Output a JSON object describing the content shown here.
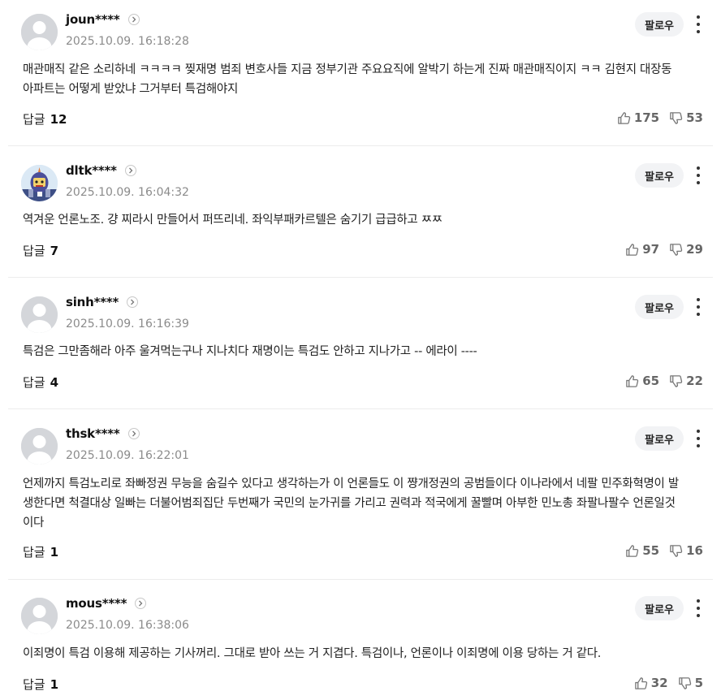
{
  "comments": [
    {
      "username": "joun****",
      "timestamp": "2025.10.09.  16:18:28",
      "follow_label": "팔로우",
      "text": "매관매직 같은 소리하네 ㅋㅋㅋㅋ 찢재명 범죄 변호사들 지금 정부기관 주요요직에 알박기 하는게 진짜 매관매직이지 ㅋㅋ 김현지 대장동 아파트는 어떻게 받았냐 그거부터 특검해야지",
      "reply_label": "답글",
      "reply_count": "12",
      "likes": "175",
      "dislikes": "53",
      "avatar": "default-avatar"
    },
    {
      "username": "dltk****",
      "timestamp": "2025.10.09.  16:04:32",
      "follow_label": "팔로우",
      "text": "역겨운 언론노조. 걍 찌라시 만들어서 퍼뜨리네. 좌익부패카르텔은 숨기기 급급하고 ㅉㅉ",
      "reply_label": "답글",
      "reply_count": "7",
      "likes": "97",
      "dislikes": "29",
      "avatar": "character-avatar"
    },
    {
      "username": "sinh****",
      "timestamp": "2025.10.09.  16:16:39",
      "follow_label": "팔로우",
      "text": "특검은 그만좀해라 아주 울겨먹는구나 지나치다 재명이는 특검도 안하고 지나가고 -- 에라이 ----",
      "reply_label": "답글",
      "reply_count": "4",
      "likes": "65",
      "dislikes": "22",
      "avatar": "default-avatar"
    },
    {
      "username": "thsk****",
      "timestamp": "2025.10.09.  16:22:01",
      "follow_label": "팔로우",
      "text": "언제까지 특검노리로 좌빠정권 무능을 숨길수 있다고 생각하는가 이 언론들도 이 쨩개정권의 공범들이다 이나라에서 네팔 민주화혁명이 발생한다면 척결대상 일빠는 더불어범죄집단 두번째가 국민의 눈가귀를 가리고 권력과 적국에게 꿀빨며 아부한 민노총 좌팔나팔수 언론일것이다",
      "reply_label": "답글",
      "reply_count": "1",
      "likes": "55",
      "dislikes": "16",
      "avatar": "default-avatar"
    },
    {
      "username": "mous****",
      "timestamp": "2025.10.09.  16:38:06",
      "follow_label": "팔로우",
      "text": "이죄명이 특검 이용해 제공하는 기사꺼리. 그대로 받아 쓰는 거 지겹다. 특검이나, 언론이나 이죄명에 이용 당하는 거 같다.",
      "reply_label": "답글",
      "reply_count": "1",
      "likes": "32",
      "dislikes": "5",
      "avatar": "default-avatar"
    }
  ]
}
